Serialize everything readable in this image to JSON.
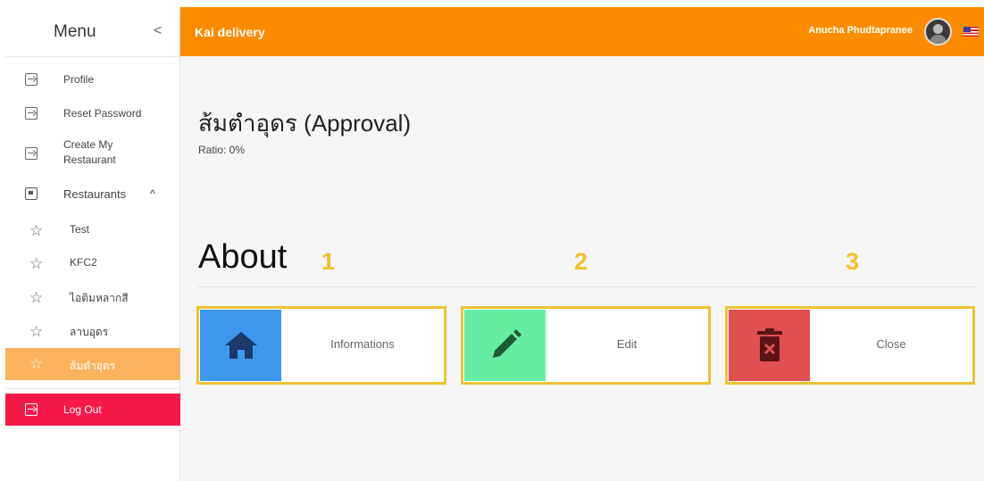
{
  "sidebar": {
    "menu_title": "Menu",
    "collapse_glyph": "<",
    "items": [
      {
        "label": "Profile",
        "icon": "login-icon"
      },
      {
        "label": "Reset Password",
        "icon": "login-icon"
      },
      {
        "label": "Create My Restaurant",
        "icon": "login-icon"
      }
    ],
    "restaurants": {
      "label": "Restaurants",
      "expand_glyph": "^",
      "children": [
        "Test",
        "KFC2",
        "ไอติมหลากสี",
        "ลาบอุดร",
        "ส้มตำอุดร"
      ],
      "active_index": 4
    },
    "logout_label": "Log Out",
    "active_color": "#fbb35c",
    "logout_color": "#f5194a"
  },
  "topbar": {
    "app_title": "Kai delivery",
    "user_name": "Anucha Phudtapranee",
    "color": "#fb8c00"
  },
  "main": {
    "page_title": "ส้มตำอุดร (Approval)",
    "ratio": "Ratio: 0%",
    "about_heading": "About",
    "cards": [
      {
        "marker": "1",
        "label": "Informations",
        "icon": "home-icon",
        "color": "#3d98ed"
      },
      {
        "marker": "2",
        "label": "Edit",
        "icon": "pencil-icon",
        "color": "#66eda4"
      },
      {
        "marker": "3",
        "label": "Close",
        "icon": "trash-icon",
        "color": "#e05050"
      }
    ],
    "highlight_color": "#f1c232"
  }
}
